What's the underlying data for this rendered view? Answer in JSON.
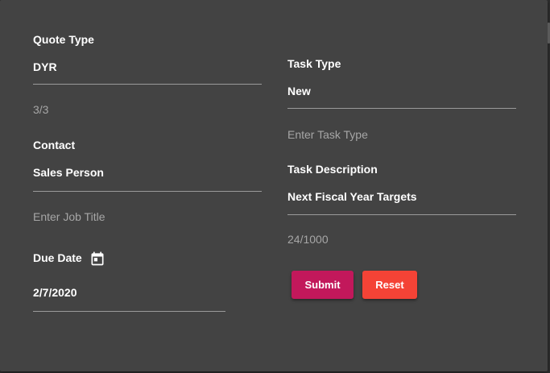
{
  "form": {
    "quote_type": {
      "label": "Quote Type",
      "value": "DYR",
      "counter": "3/3"
    },
    "contact": {
      "label": "Contact",
      "value": "Sales Person"
    },
    "job_title": {
      "placeholder": "Enter Job Title"
    },
    "due_date": {
      "label": "Due Date",
      "value": "2/7/2020"
    },
    "task_type": {
      "label": "Task Type",
      "value": "New"
    },
    "task_type_input": {
      "placeholder": "Enter Task Type"
    },
    "task_description": {
      "label": "Task Description",
      "value": "Next Fiscal Year Targets",
      "counter": "24/1000"
    }
  },
  "actions": {
    "submit_label": "Submit",
    "reset_label": "Reset"
  },
  "colors": {
    "dialog_bg": "#434343",
    "submit_bg": "#c2185b",
    "reset_bg": "#f44336"
  },
  "icons": {
    "due_date_icon": "calendar-icon"
  }
}
